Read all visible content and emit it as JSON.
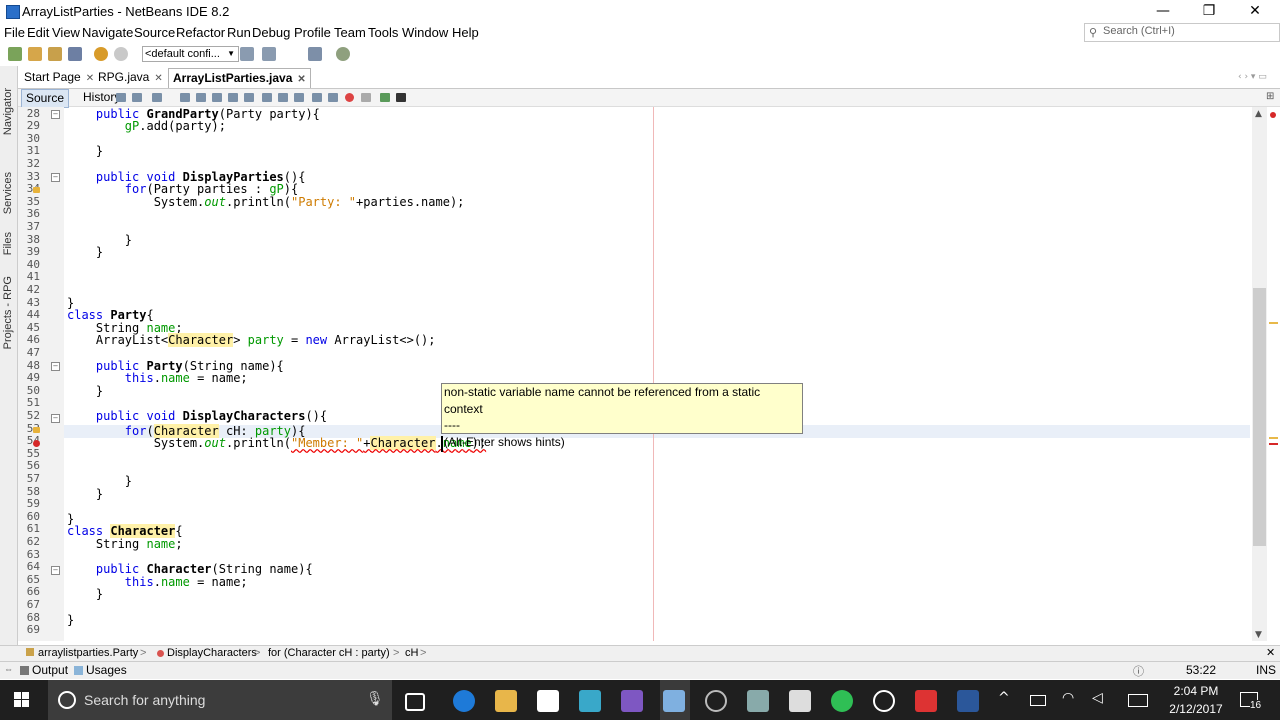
{
  "window": {
    "title": "ArrayListParties - NetBeans IDE 8.2",
    "min": "—",
    "restore": "❐",
    "close": "✕"
  },
  "menu": [
    "File",
    "Edit",
    "View",
    "Navigate",
    "Source",
    "Refactor",
    "Run",
    "Debug",
    "Profile",
    "Team",
    "Tools",
    "Window",
    "Help"
  ],
  "search": {
    "placeholder": "Search (Ctrl+I)"
  },
  "toolbar": {
    "config": "<default confi..."
  },
  "tabs": [
    {
      "label": "Start Page",
      "close": "✕"
    },
    {
      "label": "RPG.java",
      "close": "✕"
    },
    {
      "label": "ArrayListParties.java",
      "close": "✕"
    }
  ],
  "editor_tabs": {
    "source": "Source",
    "history": "History"
  },
  "sidebar": {
    "navigator": "Navigator",
    "services": "Services",
    "files": "Files",
    "projects": "Projects - RPG"
  },
  "code": {
    "lines": [
      "28",
      "29",
      "30",
      "31",
      "32",
      "33",
      "34",
      "35",
      "36",
      "37",
      "38",
      "39",
      "40",
      "41",
      "42",
      "43",
      "44",
      "45",
      "46",
      "47",
      "48",
      "49",
      "50",
      "51",
      "52",
      "53",
      "54",
      "55",
      "56",
      "57",
      "58",
      "59",
      "60",
      "61",
      "62",
      "63",
      "64",
      "65",
      "66",
      "67",
      "68",
      "69"
    ],
    "l28_kw": "public",
    "l28_m": "GrandParty",
    "l28_rest": "(Party party){",
    "l29": "gP",
    "l29_rest": ".add(party);",
    "l31": "}",
    "l33_kw": "public void",
    "l33_m": "DisplayParties",
    "l33_rest": "(){",
    "l34_kw": "for",
    "l34_a": "(Party parties : ",
    "l34_f": "gP",
    "l34_b": "){",
    "l35_a": "System.",
    "l35_out": "out",
    "l35_b": ".println(",
    "l35_s": "\"Party: \"",
    "l35_c": "+parties.name);",
    "l38": "}",
    "l39": "}",
    "l43": "}",
    "l44_kw": "class",
    "l44_n": "Party",
    "l44_b": "{",
    "l45_a": "String ",
    "l45_f": "name",
    "l45_b": ";",
    "l46_a": "ArrayList<",
    "l46_c": "Character",
    "l46_b": "> ",
    "l46_f": "party",
    "l46_d": " = ",
    "l46_kw": "new",
    "l46_e": " ArrayList<>();",
    "l48_kw": "public",
    "l48_m": "Party",
    "l48_rest": "(String name){",
    "l49_kw": "this",
    "l49_a": ".",
    "l49_f": "name",
    "l49_b": " = name;",
    "l50": "}",
    "l52_kw": "public void",
    "l52_m": "DisplayCharacters",
    "l52_rest": "(){",
    "l53_kw": "for",
    "l53_a": "(",
    "l53_c": "Character",
    "l53_b": " cH: ",
    "l53_f": "party",
    "l53_d": "){",
    "l54_a": "System.",
    "l54_out": "out",
    "l54_b": ".println(",
    "l54_s": "\"Member: \"",
    "l54_c": "+",
    "l54_ch": "Character",
    "l54_d": ".",
    "l54_e": "name",
    "l54_g": ");",
    "l57": "}",
    "l58": "}",
    "l60": "}",
    "l61_kw": "class",
    "l61_n": "Character",
    "l61_b": "{",
    "l62_a": "String ",
    "l62_f": "name",
    "l62_b": ";",
    "l64_kw": "public",
    "l64_m": "Character",
    "l64_rest": "(String name){",
    "l65_kw": "this",
    "l65_a": ".",
    "l65_f": "name",
    "l65_b": " = name;",
    "l66": "}",
    "l68": "}"
  },
  "tooltip": {
    "line1": "non-static variable name cannot be referenced from a static context",
    "line2": "----",
    "line3": "(Alt-Enter shows hints)"
  },
  "breadcrumb": [
    "arraylistparties.Party",
    "DisplayCharacters",
    "for (Character cH : party)",
    "cH"
  ],
  "status": {
    "output": "Output",
    "usages": "Usages",
    "position": "53:22",
    "mode": "INS"
  },
  "taskbar": {
    "search": "Search for anything",
    "time": "2:04 PM",
    "date": "2/12/2017",
    "notif": "16"
  }
}
